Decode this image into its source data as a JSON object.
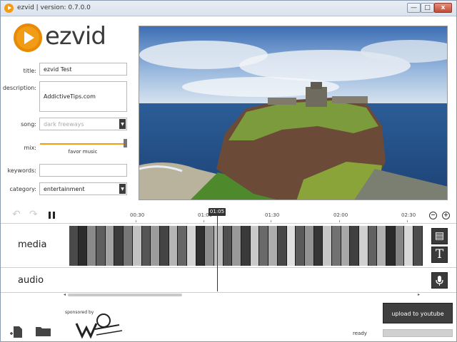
{
  "window": {
    "title": "ezvid | version: 0.7.0.0",
    "controls": {
      "minimize": "—",
      "maximize": "□",
      "close": "x"
    }
  },
  "logo": {
    "text": "ezvid"
  },
  "form": {
    "title_label": "title:",
    "title_value": "ezvid Test",
    "description_label": "description:",
    "description_value": "AddictiveTips.com",
    "song_label": "song:",
    "song_value": "dark freeways",
    "mix_label": "mix:",
    "mix_caption": "favor music",
    "mix_level_percent": 98,
    "keywords_label": "keywords:",
    "keywords_value": "",
    "category_label": "category:",
    "category_value": "entertainment"
  },
  "timeline": {
    "ticks": [
      "00:30",
      "01:00",
      "01:30",
      "02:00",
      "02:30"
    ],
    "playhead": "01:05"
  },
  "tracks": {
    "media_label": "media",
    "audio_label": "audio"
  },
  "side_tools": {
    "film": "film-icon",
    "text": "T",
    "mic": "microphone-icon"
  },
  "footer": {
    "sponsored_by": "sponsored by",
    "sponsor_logo": "wings",
    "upload_label": "upload to youtube",
    "status": "ready"
  },
  "colors": {
    "accent": "#f29b14",
    "dark_button": "#3f3f3f"
  }
}
